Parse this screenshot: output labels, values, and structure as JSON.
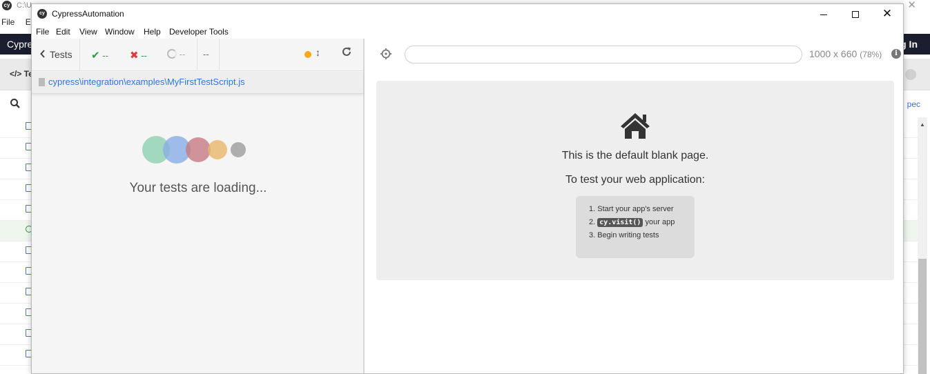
{
  "background_window": {
    "title_path": "C:\\U",
    "menu": [
      "File",
      "Ed"
    ],
    "nav_brand": "Cypre",
    "nav_login": "g In",
    "tab_label": "</> Te",
    "search_icon": "search-icon",
    "spec_link": "pec"
  },
  "window": {
    "title": "CypressAutomation",
    "logo_text": "cy",
    "controls": {
      "minimize": "minimize-icon",
      "maximize": "maximize-icon",
      "close": "✕"
    }
  },
  "menubar": [
    "File",
    "Edit",
    "View",
    "Window",
    "Help",
    "Developer Tools"
  ],
  "reporter": {
    "tests_label": "Tests",
    "passed": "--",
    "failed": "--",
    "pending": "--",
    "duration": "--",
    "spec_path": "cypress\\integration\\examples\\MyFirstTestScript.js",
    "loading_text": "Your tests are loading...",
    "status_color": "#f7a81b"
  },
  "runner": {
    "url": "",
    "viewport": "1000 x 660",
    "scale": "(78%)",
    "info": "i",
    "blank_title": "This is the default blank page.",
    "blank_subtitle": "To test your web application:",
    "steps": {
      "s1": "1. Start your app's server",
      "s2_prefix": "2.",
      "s2_code": "cy.visit()",
      "s2_suffix": "your app",
      "s3": "3. Begin writing tests"
    }
  },
  "colors": {
    "pass": "#2c9a48",
    "fail": "#e0393b",
    "link": "#2f76d8",
    "loader": [
      "#8fd1b3",
      "#88aee6",
      "#c77b84",
      "#e8b66a",
      "#9c9c9c"
    ]
  }
}
